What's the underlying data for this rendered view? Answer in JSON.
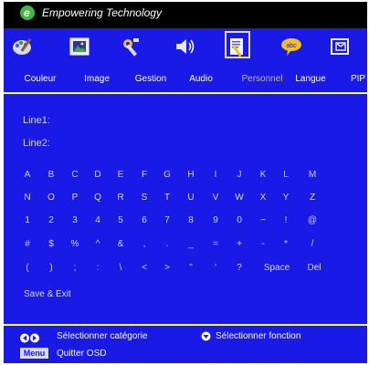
{
  "title_bar": {
    "title": "Empowering Technology",
    "logo_letter": "e"
  },
  "menu": {
    "items": [
      {
        "label": "Couleur",
        "icon": "palette-icon"
      },
      {
        "label": "Image",
        "icon": "picture-icon"
      },
      {
        "label": "Gestion",
        "icon": "tools-icon"
      },
      {
        "label": "Audio",
        "icon": "speaker-icon"
      },
      {
        "label": "Personnel",
        "icon": "document-icon",
        "selected": true
      },
      {
        "label": "Langue",
        "icon": "speech-bubble-icon",
        "icon_text": "abc"
      },
      {
        "label": "PIP",
        "icon": "pip-icon"
      }
    ]
  },
  "panel": {
    "line1_label": "Line1:",
    "line2_label": "Line2:",
    "keyboard_rows": [
      [
        "A",
        "B",
        "C",
        "D",
        "E",
        "F",
        "G",
        "H",
        "I",
        "J",
        "K",
        "L",
        "M"
      ],
      [
        "N",
        "O",
        "P",
        "Q",
        "R",
        "S",
        "T",
        "U",
        "V",
        "W",
        "X",
        "Y",
        "Z"
      ],
      [
        "1",
        "2",
        "3",
        "4",
        "5",
        "6",
        "7",
        "8",
        "9",
        "0",
        "~",
        "!",
        "@"
      ],
      [
        "#",
        "$",
        "%",
        "^",
        "&",
        ",",
        ".",
        "_",
        "=",
        "+",
        "-",
        "*",
        "/"
      ],
      [
        "(",
        ")",
        ";",
        ":",
        "\\",
        "<",
        ">",
        "\"",
        "'",
        "?",
        "Space",
        "Del"
      ]
    ],
    "save_exit": "Save  &  Exit"
  },
  "footer": {
    "select_category": "Sélectionner catégorie",
    "select_function": "Sélectionner fonction",
    "menu_key": "Menu",
    "quit_osd": "Quitter OSD"
  },
  "colors": {
    "menu_bg": "#1a1ae6",
    "selected_label": "#c9b69a",
    "logo": "#3fb93f"
  }
}
